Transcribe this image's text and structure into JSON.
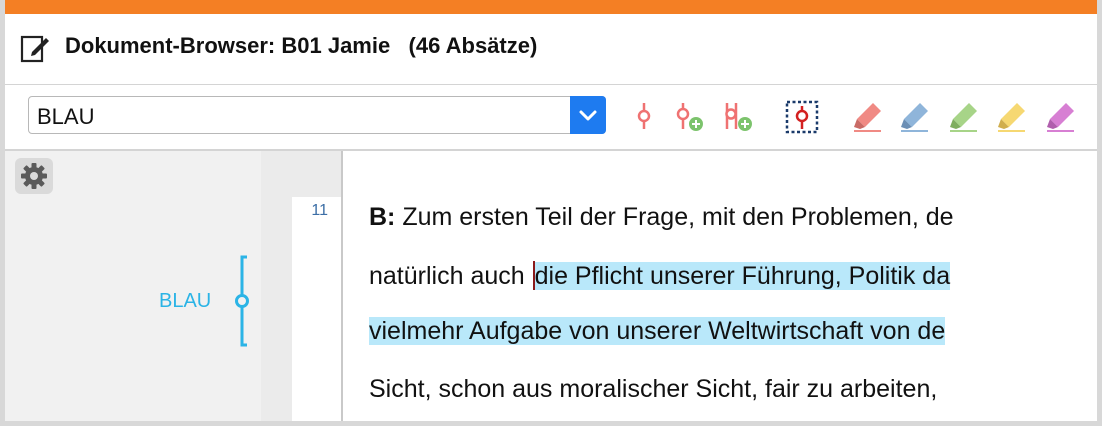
{
  "window": {
    "title": "Dokument-Browser: B01 Jamie   (46 Absätze)",
    "accent_color": "#f47f24"
  },
  "toolbar": {
    "code_select": {
      "value": "BLAU"
    },
    "icons": [
      "code-icon",
      "code-add-icon",
      "code-add-multiple-icon",
      "code-select-active-icon",
      "highlighter-red-icon",
      "highlighter-blue-icon",
      "highlighter-green-icon",
      "highlighter-yellow-icon",
      "highlighter-magenta-icon"
    ]
  },
  "left_panel": {
    "settings_icon": "gear-icon",
    "code_stripe": {
      "label": "BLAU",
      "color": "#2bb4e6"
    }
  },
  "document": {
    "paragraph_number": "11",
    "lines": [
      {
        "speaker": "B:",
        "text": " Zum ersten Teil der Frage, mit den Problemen, de"
      },
      {
        "plain": "natürlich auch ",
        "highlighted": "die Pflicht unserer Führung, Politik da"
      },
      {
        "highlighted": "vielmehr Aufgabe von unserer Weltwirtschaft von de"
      },
      {
        "plain": "Sicht, schon aus moralischer Sicht, fair zu arbeiten, "
      }
    ],
    "highlight_color": "#b9e8fa"
  }
}
